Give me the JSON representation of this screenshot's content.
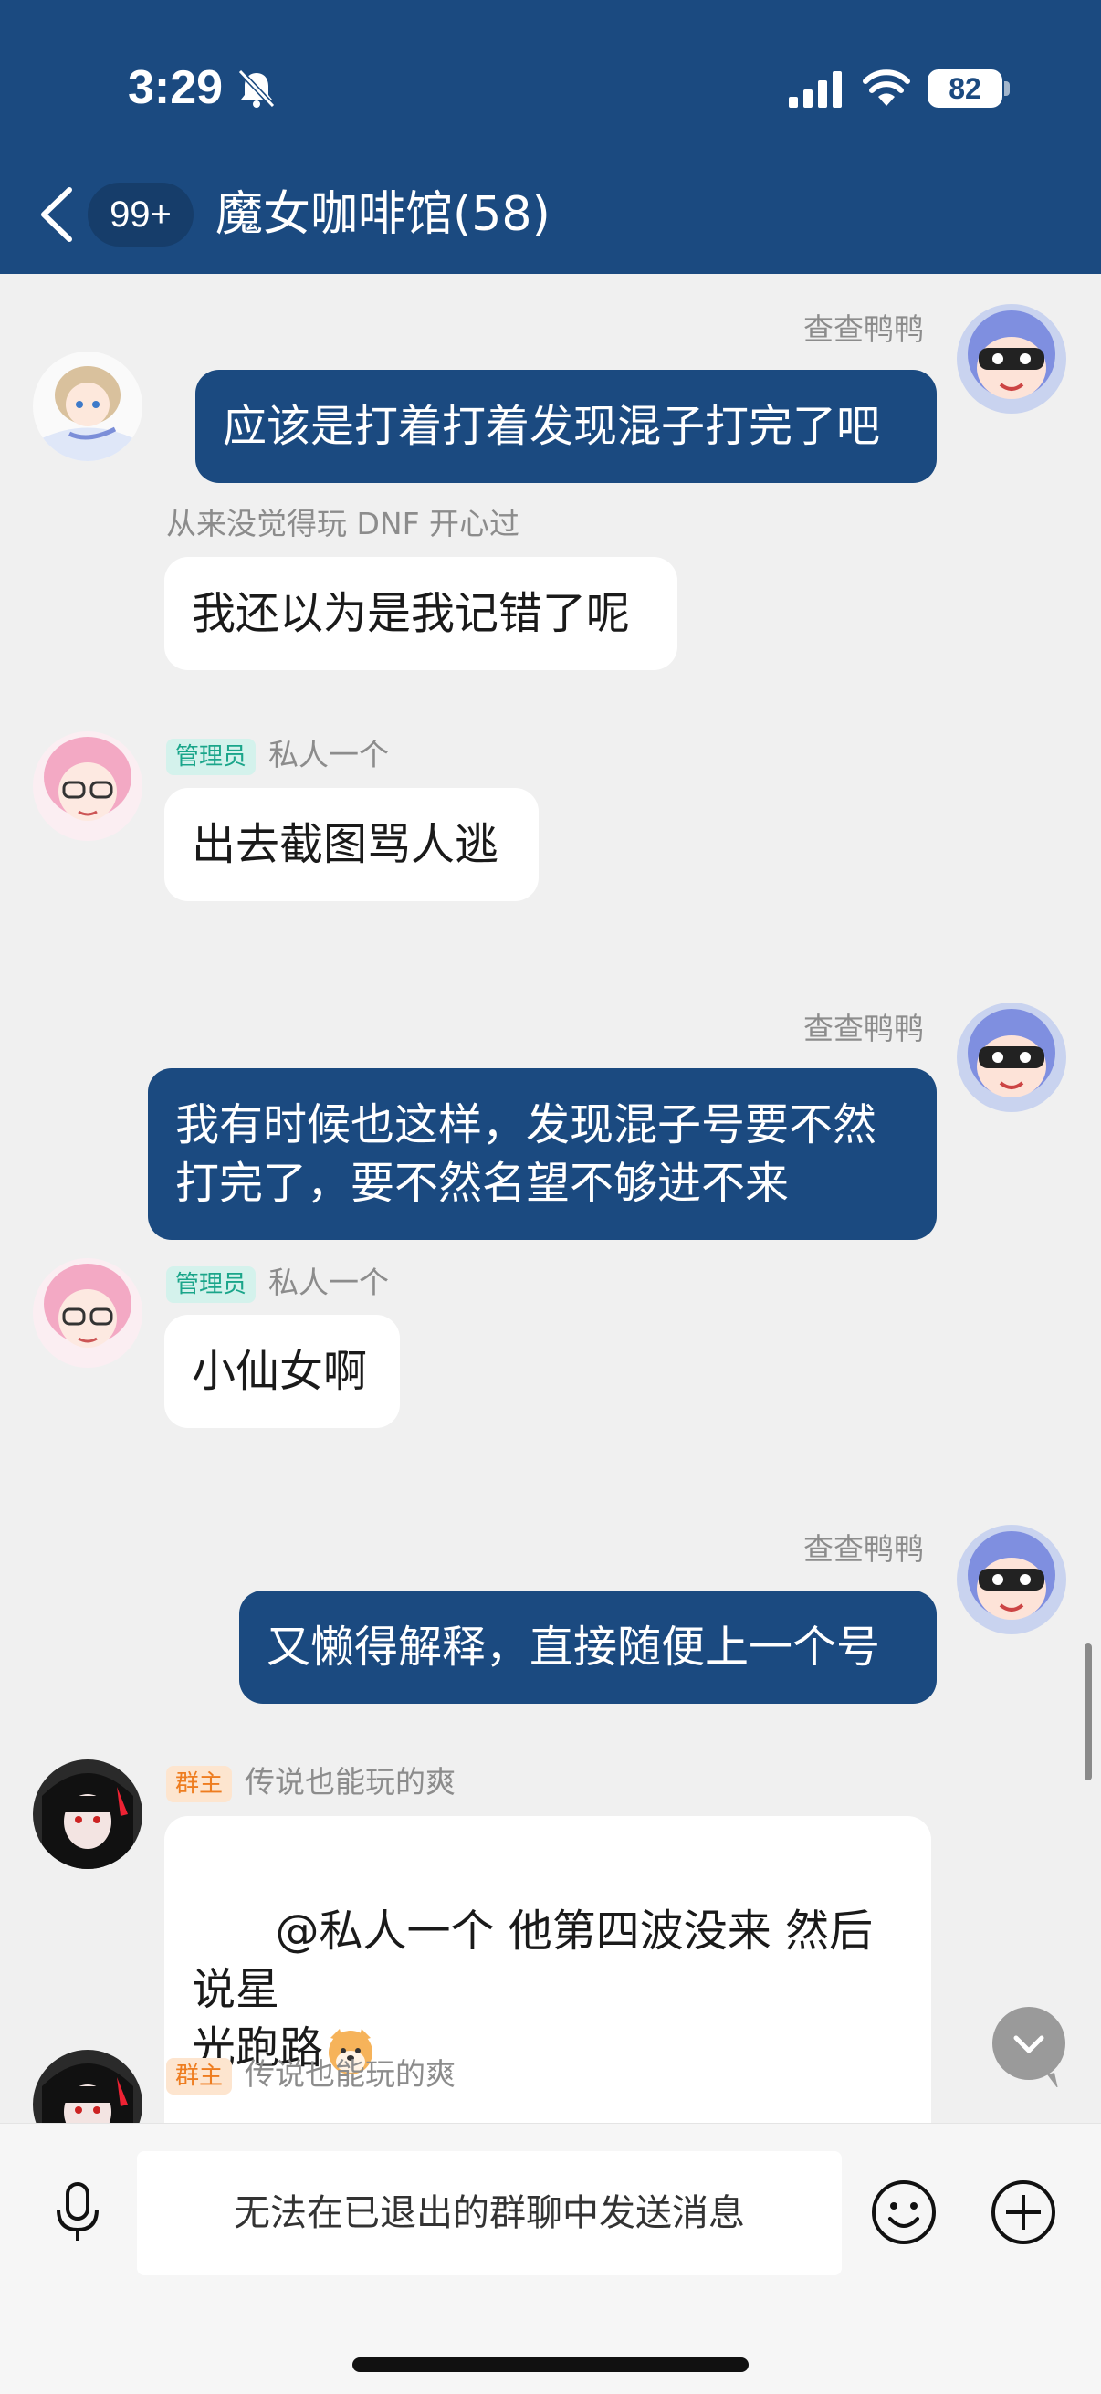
{
  "status_bar": {
    "time": "3:29",
    "battery": "82",
    "icons": [
      "bell-off-icon",
      "signal-icon",
      "wifi-icon",
      "battery-icon"
    ]
  },
  "header": {
    "back_icon": "chevron-left-icon",
    "unread_count": "99+",
    "title": "魔女咖啡馆(58)",
    "color": "#1b4a80"
  },
  "messages": [
    {
      "side": "right",
      "sender": "查查鸭鸭",
      "text": "应该是打着打着发现混子打完了吧"
    },
    {
      "side": "left",
      "sender": "从来没觉得玩 DNF 开心过",
      "text": "我还以为是我记错了呢"
    },
    {
      "side": "left",
      "role": "管理员",
      "sender": "私人一个",
      "text": "出去截图骂人逃"
    },
    {
      "side": "right",
      "sender": "查查鸭鸭",
      "text": "我有时候也这样，发现混子号要不然\n打完了，要不然名望不够进不来"
    },
    {
      "side": "left",
      "role": "管理员",
      "sender": "私人一个",
      "text": "小仙女啊"
    },
    {
      "side": "right",
      "sender": "查查鸭鸭",
      "text": "又懒得解释，直接随便上一个号"
    },
    {
      "side": "left",
      "role": "群主",
      "sender": "传说也能玩的爽",
      "text": "@私人一个 他第四波没来 然后说星\n光跑路",
      "emoji": "shiba-dog-emoji"
    },
    {
      "side": "left",
      "role": "群主",
      "sender": "传说也能玩的爽",
      "text": ""
    }
  ],
  "input": {
    "placeholder": "无法在已退出的群聊中发送消息",
    "icons": [
      "microphone-icon",
      "smiley-icon",
      "plus-circle-icon"
    ]
  },
  "colors": {
    "accent": "#1b4a80",
    "chat_bg": "#f0f0f0",
    "admin_badge": "#1aa58a",
    "owner_badge": "#ee7d20"
  }
}
